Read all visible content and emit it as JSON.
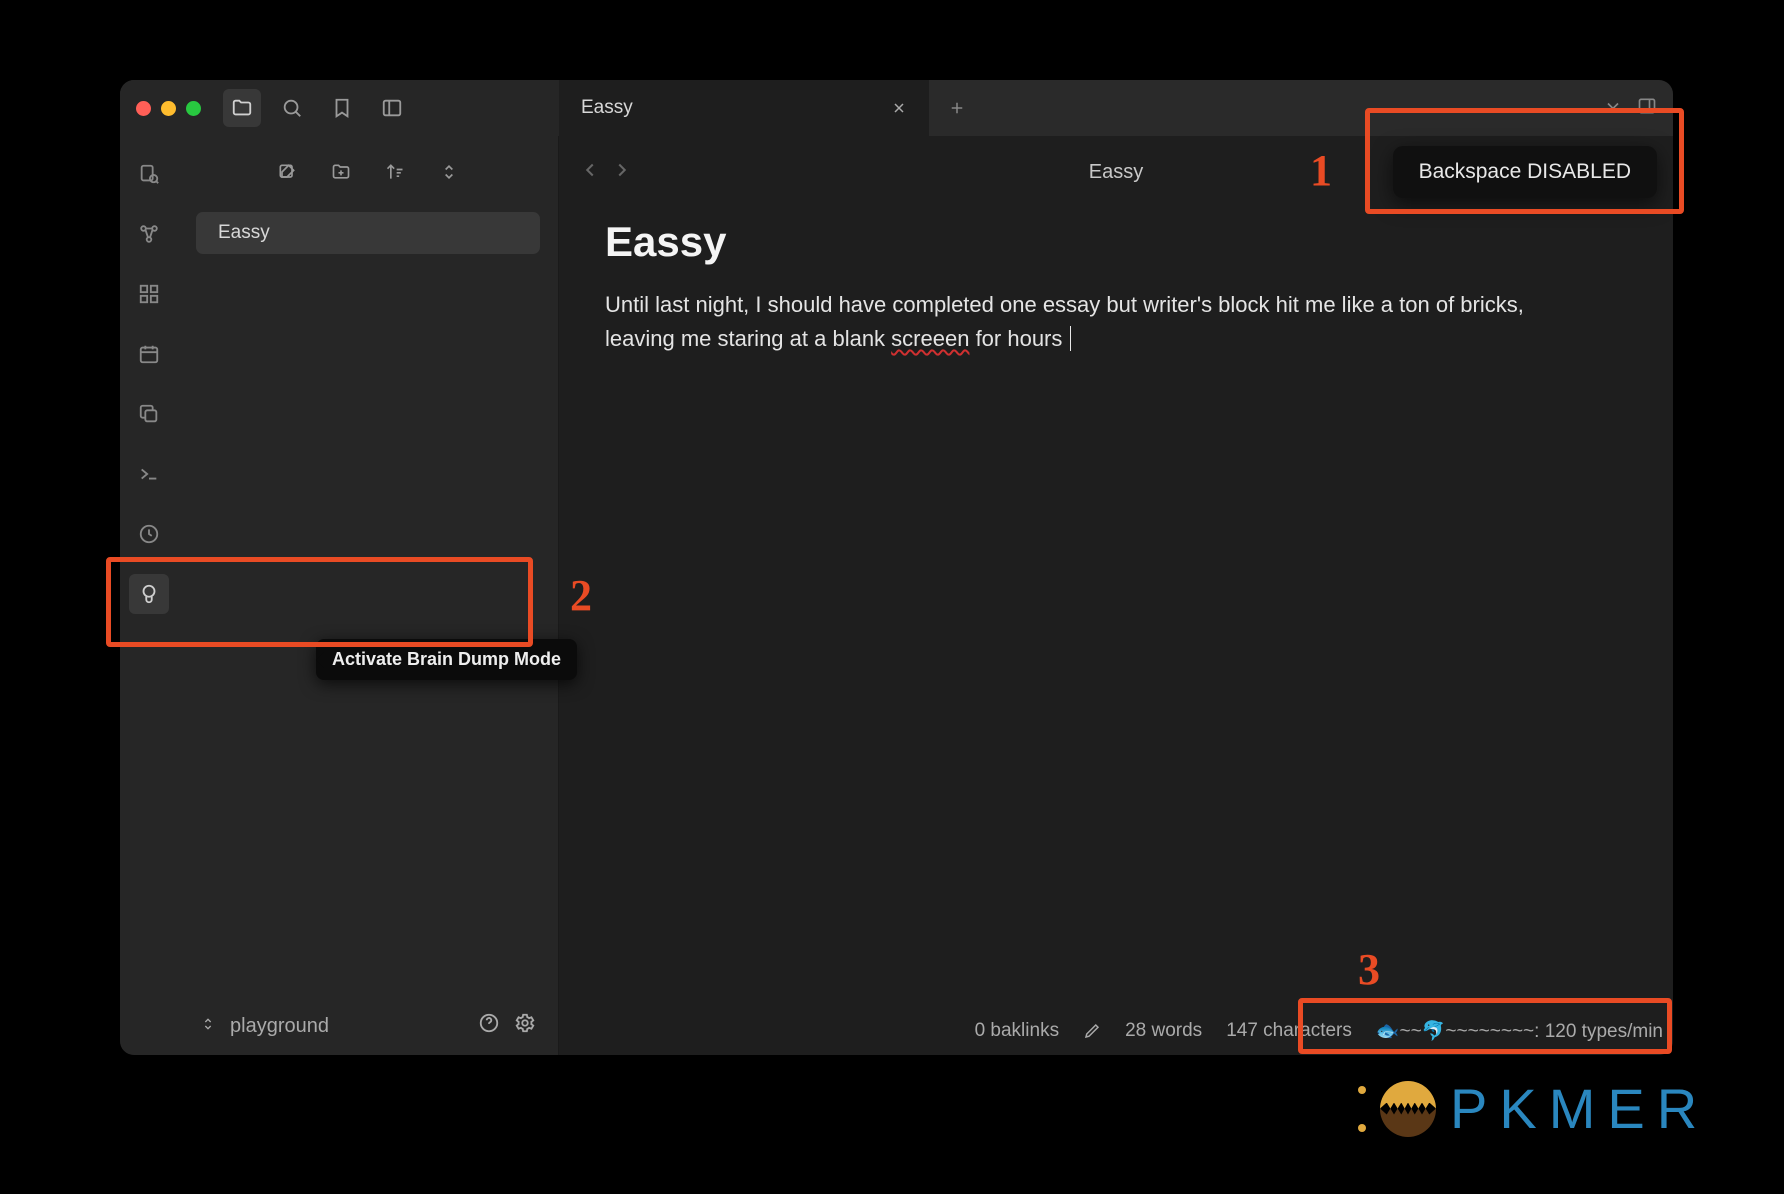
{
  "titlebar": {
    "tabs": [
      {
        "label": "Eassy"
      }
    ]
  },
  "notification": {
    "backspace": "Backspace DISABLED"
  },
  "sidebar": {
    "files": [
      {
        "name": "Eassy"
      }
    ],
    "vault": "playground"
  },
  "ribbon": {
    "tooltip": "Activate Brain Dump Mode"
  },
  "document": {
    "breadcrumb": "Eassy",
    "title": "Eassy",
    "body_pre": "Until last night, I should have completed one essay but writer's block hit me like a ton of bricks, leaving me staring at a blank ",
    "body_misspell": "screeen",
    "body_post": " for hours"
  },
  "statusbar": {
    "backlinks": "0 baklinks",
    "words": "28 words",
    "characters": "147 characters",
    "typing": "🐟~~🐬~~~~~~~~: 120 types/min"
  },
  "annotations": {
    "n1": "1",
    "n2": "2",
    "n3": "3"
  },
  "watermark": {
    "text": "PKMER"
  }
}
